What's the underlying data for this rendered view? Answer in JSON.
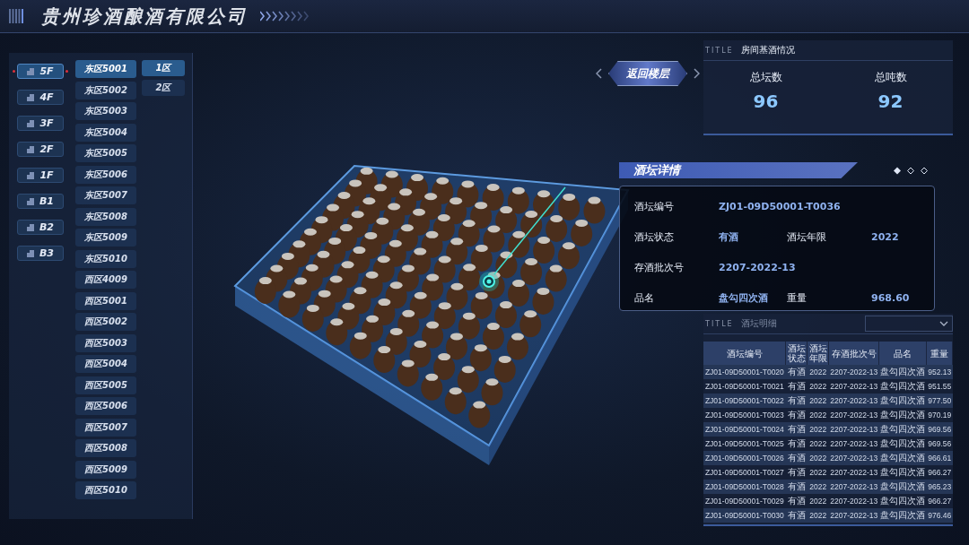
{
  "header": {
    "title": "贵州珍酒酿酒有限公司"
  },
  "floors": [
    {
      "label": "5F",
      "selected": true
    },
    {
      "label": "4F",
      "selected": false
    },
    {
      "label": "3F",
      "selected": false
    },
    {
      "label": "2F",
      "selected": false
    },
    {
      "label": "1F",
      "selected": false
    },
    {
      "label": "B1",
      "selected": false
    },
    {
      "label": "B2",
      "selected": false
    },
    {
      "label": "B3",
      "selected": false
    }
  ],
  "rooms": [
    {
      "label": "东区5001",
      "selected": true
    },
    {
      "label": "东区5002",
      "selected": false
    },
    {
      "label": "东区5003",
      "selected": false
    },
    {
      "label": "东区5004",
      "selected": false
    },
    {
      "label": "东区5005",
      "selected": false
    },
    {
      "label": "东区5006",
      "selected": false
    },
    {
      "label": "东区5007",
      "selected": false
    },
    {
      "label": "东区5008",
      "selected": false
    },
    {
      "label": "东区5009",
      "selected": false
    },
    {
      "label": "东区5010",
      "selected": false
    },
    {
      "label": "西区4009",
      "selected": false
    },
    {
      "label": "西区5001",
      "selected": false
    },
    {
      "label": "西区5002",
      "selected": false
    },
    {
      "label": "西区5003",
      "selected": false
    },
    {
      "label": "西区5004",
      "selected": false
    },
    {
      "label": "西区5005",
      "selected": false
    },
    {
      "label": "西区5006",
      "selected": false
    },
    {
      "label": "西区5007",
      "selected": false
    },
    {
      "label": "西区5008",
      "selected": false
    },
    {
      "label": "西区5009",
      "selected": false
    },
    {
      "label": "西区5010",
      "selected": false
    }
  ],
  "zones": [
    {
      "label": "1区",
      "selected": true
    },
    {
      "label": "2区",
      "selected": false
    }
  ],
  "return_button": {
    "label": "返回楼层"
  },
  "room_stats": {
    "tag": "TITLE",
    "title": "房间基酒情况",
    "metrics": [
      {
        "label": "总坛数",
        "value": "96"
      },
      {
        "label": "总吨数",
        "value": "92"
      }
    ]
  },
  "jar_detail": {
    "title": "酒坛详情",
    "rows": [
      [
        {
          "label": "酒坛编号",
          "value": "ZJ01-09D50001-T0036"
        }
      ],
      [
        {
          "label": "酒坛状态",
          "value": "有酒"
        },
        {
          "label": "酒坛年限",
          "value": "2022"
        }
      ],
      [
        {
          "label": "存酒批次号",
          "value": "2207-2022-13"
        }
      ],
      [
        {
          "label": "品名",
          "value": "盘勾四次酒"
        },
        {
          "label": "重量",
          "value": "968.60"
        }
      ]
    ]
  },
  "jar_table": {
    "tag": "TITLE",
    "title": "酒坛明细",
    "columns": [
      "酒坛编号",
      "酒坛状态",
      "酒坛年限",
      "存酒批次号",
      "品名",
      "重量"
    ],
    "rows": [
      [
        "ZJ01-09D50001-T0020",
        "有酒",
        "2022",
        "2207-2022-13",
        "盘勾四次酒",
        "952.13"
      ],
      [
        "ZJ01-09D50001-T0021",
        "有酒",
        "2022",
        "2207-2022-13",
        "盘勾四次酒",
        "951.55"
      ],
      [
        "ZJ01-09D50001-T0022",
        "有酒",
        "2022",
        "2207-2022-13",
        "盘勾四次酒",
        "977.50"
      ],
      [
        "ZJ01-09D50001-T0023",
        "有酒",
        "2022",
        "2207-2022-13",
        "盘勾四次酒",
        "970.19"
      ],
      [
        "ZJ01-09D50001-T0024",
        "有酒",
        "2022",
        "2207-2022-13",
        "盘勾四次酒",
        "969.56"
      ],
      [
        "ZJ01-09D50001-T0025",
        "有酒",
        "2022",
        "2207-2022-13",
        "盘勾四次酒",
        "969.56"
      ],
      [
        "ZJ01-09D50001-T0026",
        "有酒",
        "2022",
        "2207-2022-13",
        "盘勾四次酒",
        "966.61"
      ],
      [
        "ZJ01-09D50001-T0027",
        "有酒",
        "2022",
        "2207-2022-13",
        "盘勾四次酒",
        "966.27"
      ],
      [
        "ZJ01-09D50001-T0028",
        "有酒",
        "2022",
        "2207-2022-13",
        "盘勾四次酒",
        "965.23"
      ],
      [
        "ZJ01-09D50001-T0029",
        "有酒",
        "2022",
        "2207-2022-13",
        "盘勾四次酒",
        "966.27"
      ],
      [
        "ZJ01-09D50001-T0030",
        "有酒",
        "2022",
        "2207-2022-13",
        "盘勾四次酒",
        "976.46"
      ]
    ]
  }
}
